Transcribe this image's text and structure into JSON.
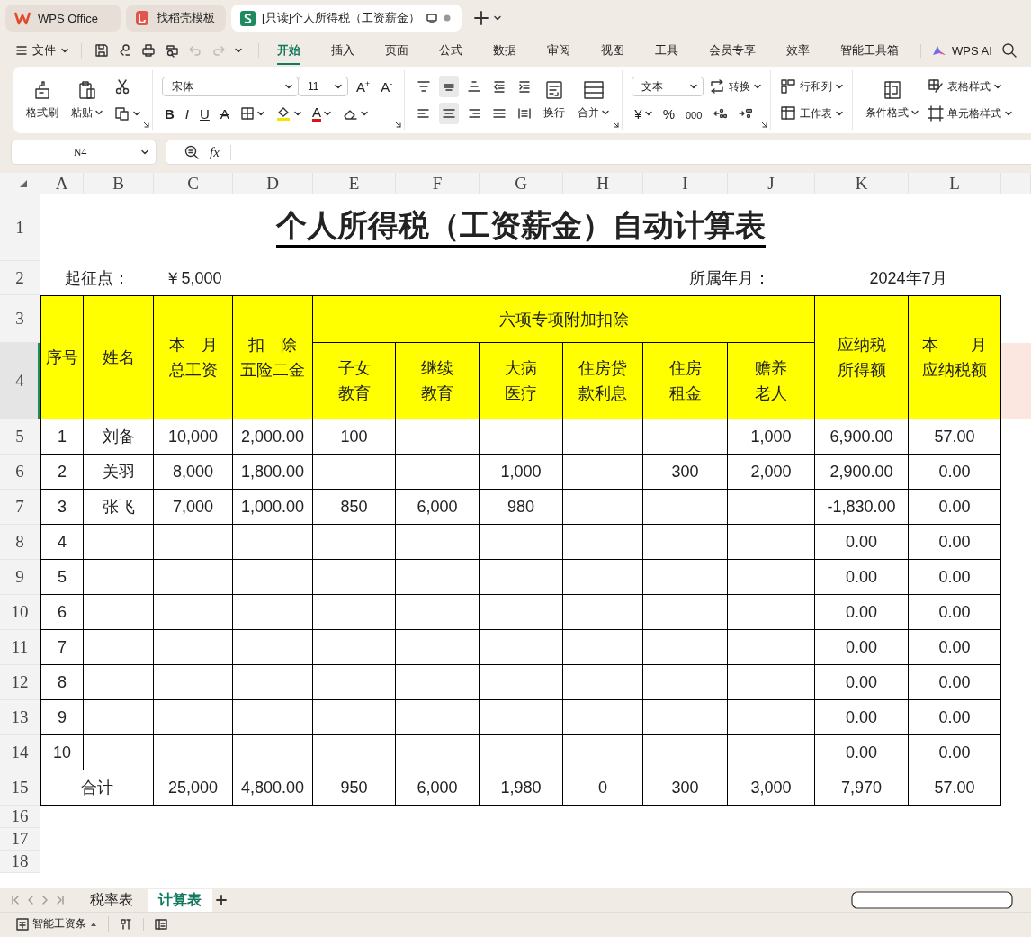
{
  "window_tabs": [
    {
      "kind": "home",
      "label": "WPS Office",
      "selected": false
    },
    {
      "kind": "template",
      "label": "找稻壳模板",
      "selected": false
    },
    {
      "kind": "sheet",
      "label": "[只读]个人所得税（工资薪金）",
      "selected": true
    }
  ],
  "menu": {
    "file": "文件",
    "tabs": [
      {
        "label": "开始",
        "selected": true
      },
      {
        "label": "插入",
        "selected": false
      },
      {
        "label": "页面",
        "selected": false
      },
      {
        "label": "公式",
        "selected": false
      },
      {
        "label": "数据",
        "selected": false
      },
      {
        "label": "审阅",
        "selected": false
      },
      {
        "label": "视图",
        "selected": false
      },
      {
        "label": "工具",
        "selected": false
      },
      {
        "label": "会员专享",
        "selected": false
      },
      {
        "label": "效率",
        "selected": false
      },
      {
        "label": "智能工具箱",
        "selected": false
      }
    ],
    "ai": "WPS AI"
  },
  "ribbon": {
    "clipboard": {
      "format_painter": "格式刷",
      "paste": "粘贴"
    },
    "font": {
      "name": "宋体",
      "size": "11",
      "grow": "A$^{+}$",
      "shrink": "A$^{-}$",
      "bold": "B",
      "italic": "I",
      "underline": "U",
      "strike": "A",
      "font_color": "A"
    },
    "alignment": {
      "wrap": "换行",
      "merge": "合并"
    },
    "number": {
      "format": "文本",
      "convert": "转换",
      "currency": "¥",
      "percent": "%",
      "thousands": "000"
    },
    "cells": {
      "rows_cols": "行和列",
      "worksheet": "工作表"
    },
    "styles": {
      "conditional": "条件格式",
      "table_style": "表格样式",
      "cell_style": "单元格样式"
    }
  },
  "formula_bar": {
    "name_box": "N4",
    "fx": "fx"
  },
  "sheet": {
    "columns": [
      "A",
      "B",
      "C",
      "D",
      "E",
      "F",
      "G",
      "H",
      "I",
      "J",
      "K",
      "L"
    ],
    "rows": [
      {
        "label": "1",
        "selected": false
      },
      {
        "label": "2",
        "selected": false
      },
      {
        "label": "3",
        "selected": false
      },
      {
        "label": "4",
        "selected": true
      },
      {
        "label": "5",
        "selected": false
      },
      {
        "label": "6",
        "selected": false
      },
      {
        "label": "7",
        "selected": false
      },
      {
        "label": "8",
        "selected": false
      },
      {
        "label": "9",
        "selected": false
      },
      {
        "label": "10",
        "selected": false
      },
      {
        "label": "11",
        "selected": false
      },
      {
        "label": "12",
        "selected": false
      },
      {
        "label": "13",
        "selected": false
      },
      {
        "label": "14",
        "selected": false
      },
      {
        "label": "15",
        "selected": false
      },
      {
        "label": "16",
        "selected": false
      },
      {
        "label": "17",
        "selected": false
      },
      {
        "label": "18",
        "selected": false
      }
    ],
    "title": "个人所得税（工资薪金）自动计算表",
    "info_cells": {
      "A2:B2": "起征点：",
      "C2": "￥5,000",
      "I2:J2": "所属年月：",
      "K2:L2": "2024年7月"
    },
    "header_cells": {
      "A3:A4": [
        "序号"
      ],
      "B3:B4": [
        "姓名"
      ],
      "C3:C4": [
        "本　月",
        "总工资"
      ],
      "D3:D4": [
        "扣　除",
        "五险二金"
      ],
      "E3:J3": [
        "六项专项附加扣除"
      ],
      "E4": [
        "子女",
        "教育"
      ],
      "F4": [
        "继续",
        "教育"
      ],
      "G4": [
        "大病",
        "医疗"
      ],
      "H4": [
        "住房贷",
        "款利息"
      ],
      "I4": [
        "住房",
        "租金"
      ],
      "J4": [
        "赡养",
        "老人"
      ],
      "K3:K4": [
        "应纳税",
        "所得额"
      ],
      "L3:L4": [
        "本　　月",
        "应纳税额"
      ]
    },
    "cells": {
      "A5": "1",
      "B5": "刘备",
      "C5": "10,000",
      "D5": "2,000.00",
      "E5": "100",
      "J5": "1,000",
      "K5": "6,900.00",
      "L5": "57.00",
      "A6": "2",
      "B6": "关羽",
      "C6": "8,000",
      "D6": "1,800.00",
      "G6": "1,000",
      "I6": "300",
      "J6": "2,000",
      "K6": "2,900.00",
      "L6": "0.00",
      "A7": "3",
      "B7": "张飞",
      "C7": "7,000",
      "D7": "1,000.00",
      "E7": "850",
      "F7": "6,000",
      "G7": "980",
      "K7": "-1,830.00",
      "L7": "0.00",
      "A8": "4",
      "K8": "0.00",
      "L8": "0.00",
      "A9": "5",
      "K9": "0.00",
      "L9": "0.00",
      "A10": "6",
      "K10": "0.00",
      "L10": "0.00",
      "A11": "7",
      "K11": "0.00",
      "L11": "0.00",
      "A12": "8",
      "K12": "0.00",
      "L12": "0.00",
      "A13": "9",
      "K13": "0.00",
      "L13": "0.00",
      "A14": "10",
      "K14": "0.00",
      "L14": "0.00",
      "A15:B15": "合计",
      "C15": "25,000",
      "D15": "4,800.00",
      "E15": "950",
      "F15": "6,000",
      "G15": "1,980",
      "H15": "0",
      "I15": "300",
      "J15": "3,000",
      "K15": "7,970",
      "L15": "57.00"
    }
  },
  "sheet_tabs": [
    {
      "label": "税率表",
      "selected": false
    },
    {
      "label": "计算表",
      "selected": true
    }
  ],
  "status_bar": {
    "label": "智能工资条"
  }
}
